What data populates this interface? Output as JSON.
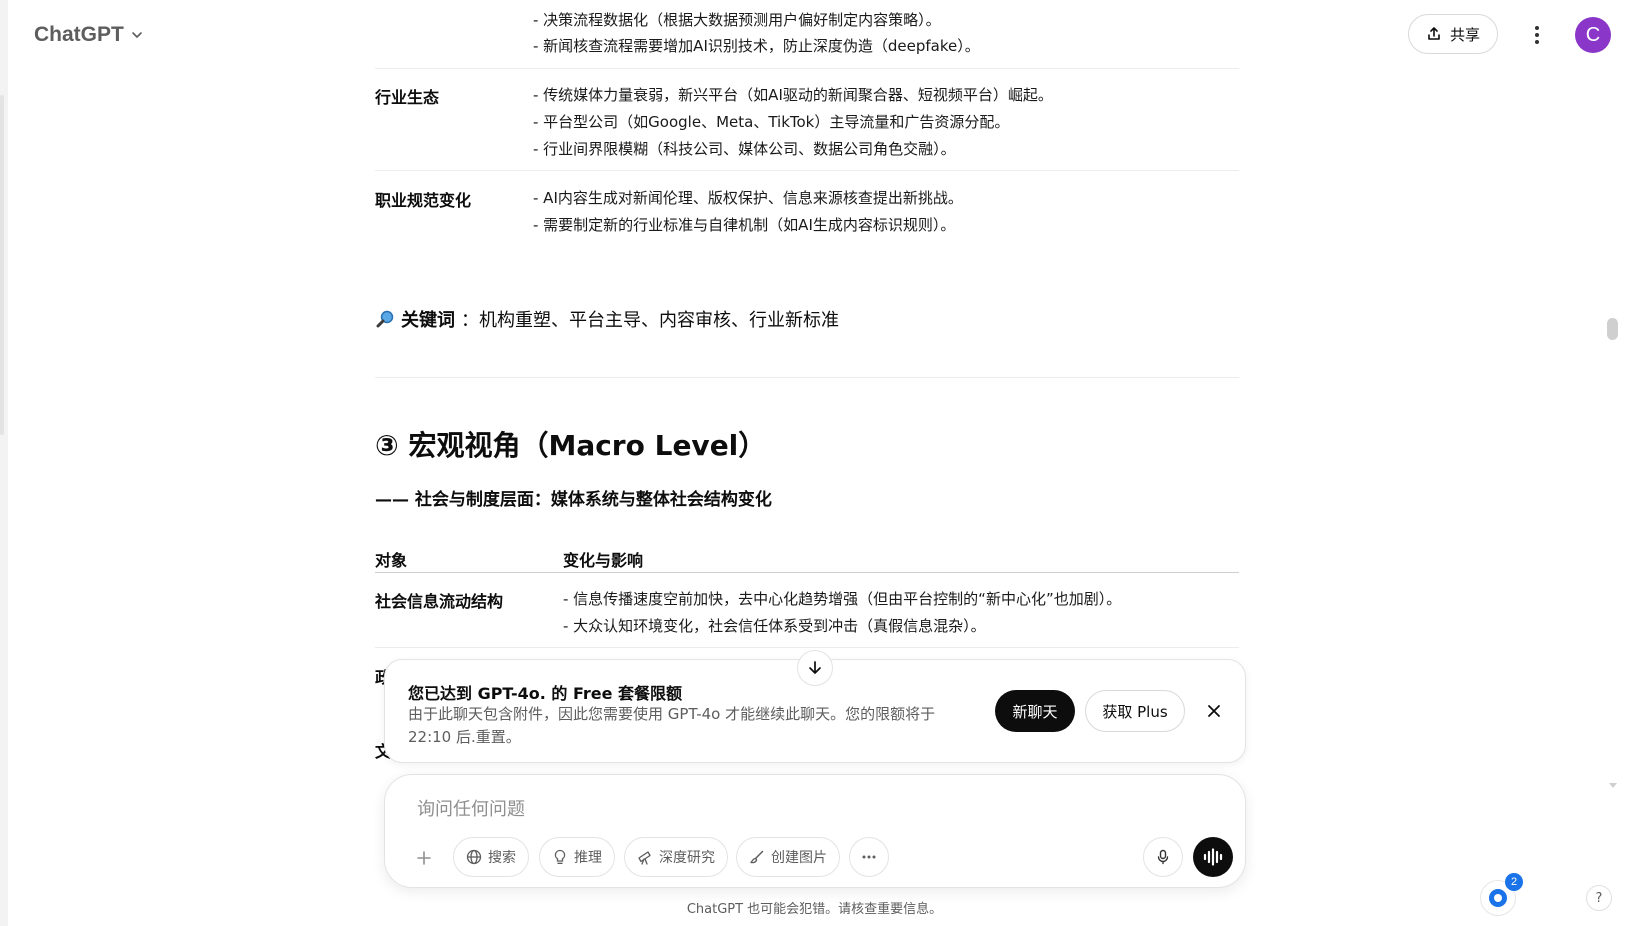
{
  "header": {
    "brand_title": "ChatGPT",
    "share_label": "共享",
    "avatar_letter": "C"
  },
  "content": {
    "rows_top": [
      {
        "label": "",
        "lines": [
          "- 决策流程数据化（根据大数据预测用户偏好制定内容策略）。",
          "- 新闻核查流程需要增加AI识别技术，防止深度伪造（deepfake）。"
        ]
      },
      {
        "label": "行业生态",
        "lines": [
          "- 传统媒体力量衰弱，新兴平台（如AI驱动的新闻聚合器、短视频平台）崛起。",
          "- 平台型公司（如Google、Meta、TikTok）主导流量和广告资源分配。",
          "- 行业间界限模糊（科技公司、媒体公司、数据公司角色交融）。"
        ]
      },
      {
        "label": "职业规范变化",
        "lines": [
          "- AI内容生成对新闻伦理、版权保护、信息来源核查提出新挑战。",
          "- 需要制定新的行业标准与自律机制（如AI生成内容标识规则）。"
        ]
      }
    ],
    "keyword_label": "关键词",
    "keyword_text": "：机构重塑、平台主导、内容审核、行业新标准",
    "section_title": "③ 宏观视角（Macro Level）",
    "section_sub": "—— 社会与制度层面：媒体系统与整体社会结构变化",
    "table_head": {
      "col1": "对象",
      "col2": "变化与影响"
    },
    "macro_rows": [
      {
        "label": "社会信息流动结构",
        "lines": [
          "- 信息传播速度空前加快，去中心化趋势增强（但由平台控制的“新中心化”也加剧）。",
          "- 大众认知环境变化，社会信任体系受到冲击（真假信息混杂）。"
        ]
      }
    ],
    "clipped_label_1": "政",
    "clipped_label_2": "文"
  },
  "banner": {
    "title": "您已达到 GPT-4o. 的 Free 套餐限额",
    "text": "由于此聊天包含附件，因此您需要使用 GPT-4o 才能继续此聊天。您的限额将于 22:10 后.重置。",
    "new_chat_label": "新聊天",
    "get_plus_label": "获取 Plus"
  },
  "composer": {
    "placeholder": "询问任何问题",
    "tools": [
      "搜索",
      "推理",
      "深度研究",
      "创建图片"
    ]
  },
  "footer_note": "ChatGPT 也可能会犯错。请核查重要信息。",
  "notif_count": "2",
  "help_label": "?"
}
